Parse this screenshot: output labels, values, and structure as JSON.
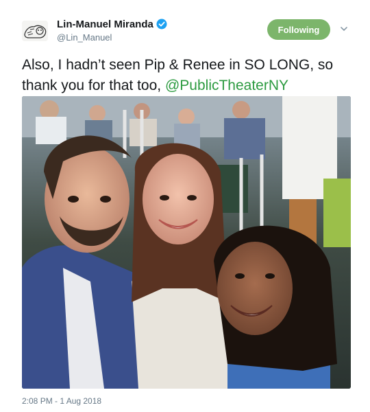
{
  "user": {
    "display_name": "Lin-Manuel Miranda",
    "handle": "@Lin_Manuel",
    "verified": true,
    "avatar_icon": "avatar-sketch"
  },
  "actions": {
    "follow_label": "Following",
    "follow_color": "#7cb56b",
    "menu_icon": "chevron-down-icon"
  },
  "tweet": {
    "text": "Also, I hadn’t seen Pip & Renee in SO LONG, so thank you for that too, ",
    "mention": "@PublicTheaterNY",
    "mention_color": "#2b9a3f",
    "timestamp": "2:08 PM - 1 Aug 2018"
  },
  "media": {
    "type": "photo",
    "description_icon": "selfie-photo"
  }
}
